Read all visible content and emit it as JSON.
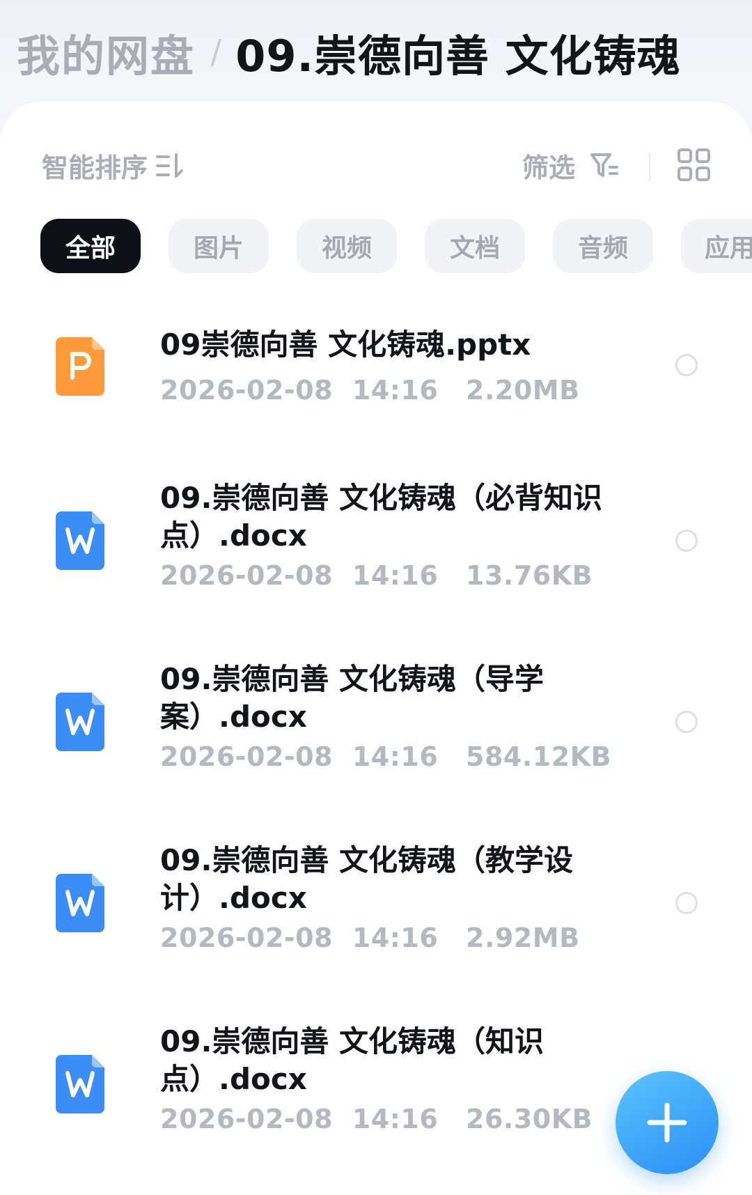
{
  "header": {
    "root_label": "我的网盘",
    "separator": "/",
    "current_folder": "09.崇德向善 文化铸魂"
  },
  "toolbar": {
    "sort_label": "智能排序",
    "filter_label": "筛选",
    "icons": {
      "sort": "sort-lines-icon",
      "filter": "funnel-filter-icon",
      "view": "grid-view-icon"
    }
  },
  "tabs": [
    {
      "label": "全部",
      "active": true
    },
    {
      "label": "图片",
      "active": false
    },
    {
      "label": "视频",
      "active": false
    },
    {
      "label": "文档",
      "active": false
    },
    {
      "label": "音频",
      "active": false
    },
    {
      "label": "应用",
      "active": false
    }
  ],
  "files": [
    {
      "name": "09崇德向善 文化铸魂.pptx",
      "date": "2026-02-08",
      "time": "14:16",
      "size": "2.20MB",
      "type": "pptx",
      "icon_letter": "P",
      "icon_color": "#ff9a3c"
    },
    {
      "name": "09.崇德向善 文化铸魂（必背知识点）.docx",
      "date": "2026-02-08",
      "time": "14:16",
      "size": "13.76KB",
      "type": "docx",
      "icon_letter": "W",
      "icon_color": "#3b8cf5"
    },
    {
      "name": "09.崇德向善 文化铸魂（导学案）.docx",
      "date": "2026-02-08",
      "time": "14:16",
      "size": "584.12KB",
      "type": "docx",
      "icon_letter": "W",
      "icon_color": "#3b8cf5"
    },
    {
      "name": "09.崇德向善 文化铸魂（教学设计）.docx",
      "date": "2026-02-08",
      "time": "14:16",
      "size": "2.92MB",
      "type": "docx",
      "icon_letter": "W",
      "icon_color": "#3b8cf5"
    },
    {
      "name": "09.崇德向善 文化铸魂（知识点）.docx",
      "date": "2026-02-08",
      "time": "14:16",
      "size": "26.30KB",
      "type": "docx",
      "icon_letter": "W",
      "icon_color": "#3b8cf5"
    }
  ],
  "fab": {
    "icon": "plus-icon"
  },
  "colors": {
    "accent": "#3b8cf5",
    "active_tab": "#0d1117",
    "muted_text": "#a8adb7",
    "pptx": "#ff9a3c",
    "docx": "#3b8cf5"
  }
}
